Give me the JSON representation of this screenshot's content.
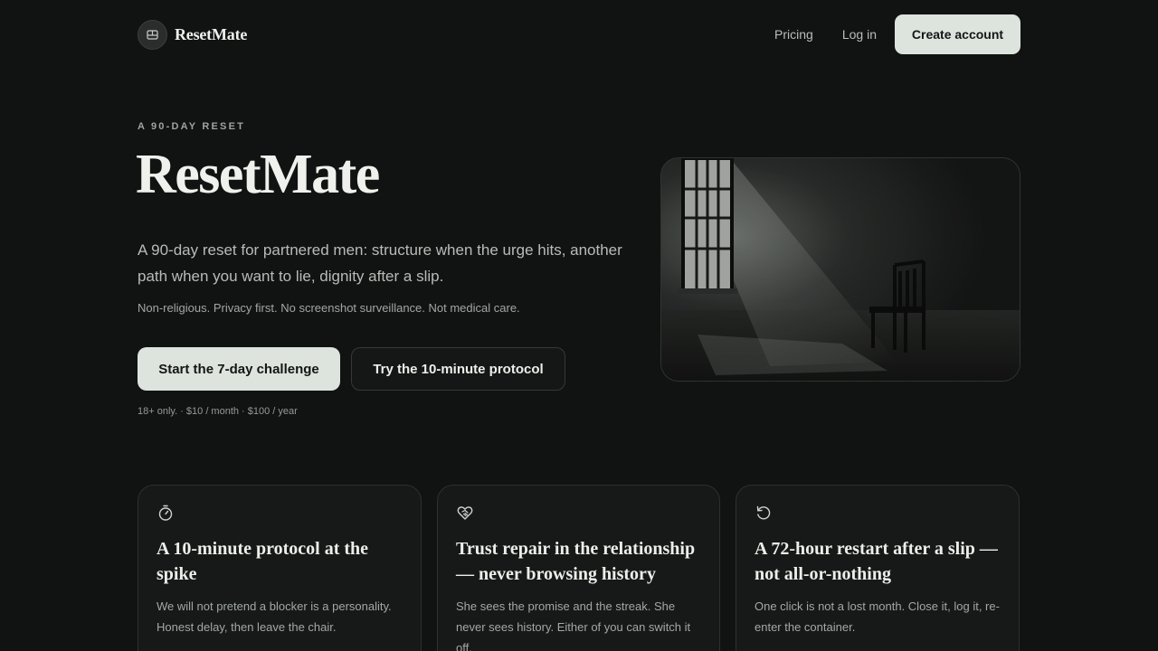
{
  "nav": {
    "brand": "ResetMate",
    "links": {
      "pricing": "Pricing",
      "login": "Log in"
    },
    "create_account": "Create account"
  },
  "hero": {
    "eyebrow": "A 90-DAY RESET",
    "title": "ResetMate",
    "subtitle": "A 90-day reset for partnered men: structure when the urge hits, another path when you want to lie, dignity after a slip.",
    "note": "Non-religious. Privacy first. No screenshot surveillance. Not medical care.",
    "primary_cta": "Start the 7-day challenge",
    "secondary_cta": "Try the 10-minute protocol",
    "price_note": "18+ only. · $10 / month · $100 / year"
  },
  "cards": [
    {
      "icon": "timer-icon",
      "title": "A 10-minute protocol at the spike",
      "body": "We will not pretend a blocker is a personality. Honest delay, then leave the chair."
    },
    {
      "icon": "heart-handshake-icon",
      "title": "Trust repair in the relationship — never browsing history",
      "body": "She sees the promise and the streak. She never sees history. Either of you can switch it off."
    },
    {
      "icon": "restart-icon",
      "title": "A 72-hour restart after a slip — not all-or-nothing",
      "body": "One click is not a lost month. Close it, log it, re-enter the container."
    }
  ],
  "colors": {
    "background": "#111313",
    "button_light": "#dde3dd",
    "card_bg": "#161918"
  }
}
